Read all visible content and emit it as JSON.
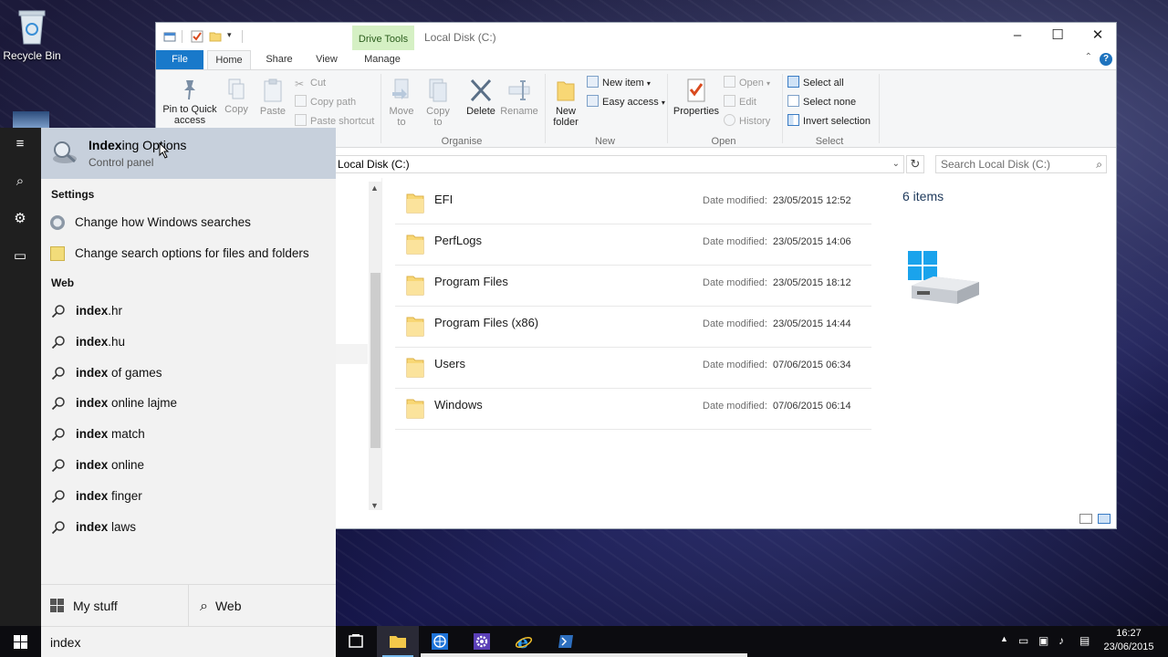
{
  "desktop": {
    "recycle_bin_label": "Recycle Bin"
  },
  "explorer": {
    "contextual_tab_label": "Drive Tools",
    "window_title": "Local Disk (C:)",
    "tabs": {
      "file": "File",
      "home": "Home",
      "share": "Share",
      "view": "View",
      "manage": "Manage"
    },
    "ribbon": {
      "clipboard": {
        "pin_label": "Pin to Quick access",
        "copy_label": "Copy",
        "paste_label": "Paste",
        "cut_label": "Cut",
        "copy_path_label": "Copy path",
        "paste_shortcut_label": "Paste shortcut"
      },
      "organise": {
        "move_to_label": "Move to",
        "copy_to_label": "Copy to",
        "delete_label": "Delete",
        "rename_label": "Rename",
        "group_label": "Organise"
      },
      "new": {
        "new_folder_label": "New folder",
        "new_item_label": "New item",
        "easy_access_label": "Easy access",
        "group_label": "New"
      },
      "open": {
        "properties_label": "Properties",
        "open_label": "Open",
        "edit_label": "Edit",
        "history_label": "History",
        "group_label": "Open"
      },
      "select": {
        "select_all_label": "Select all",
        "select_none_label": "Select none",
        "invert_selection_label": "Invert selection",
        "group_label": "Select"
      }
    },
    "address": "Local Disk (C:)",
    "search_placeholder": "Search Local Disk (C:)",
    "date_modified_label": "Date modified:",
    "files": [
      {
        "name": "EFI",
        "date": "23/05/2015 12:52"
      },
      {
        "name": "PerfLogs",
        "date": "23/05/2015 14:06"
      },
      {
        "name": "Program Files",
        "date": "23/05/2015 18:12"
      },
      {
        "name": "Program Files (x86)",
        "date": "23/05/2015 14:44"
      },
      {
        "name": "Users",
        "date": "07/06/2015 06:34"
      },
      {
        "name": "Windows",
        "date": "07/06/2015 06:14"
      }
    ],
    "item_count": "6 items"
  },
  "search_panel": {
    "best_match": {
      "title_bold": "Index",
      "title_rest": "ing Options",
      "subtitle": "Control panel"
    },
    "settings_header": "Settings",
    "settings_items": [
      {
        "label": "Change how Windows searches"
      },
      {
        "label": "Change search options for files and folders"
      }
    ],
    "web_header": "Web",
    "web_items": [
      {
        "bold": "index",
        "rest": ".hr"
      },
      {
        "bold": "index",
        "rest": ".hu"
      },
      {
        "bold": "index",
        "rest": " of games"
      },
      {
        "bold": "index",
        "rest": " online lajme"
      },
      {
        "bold": "index",
        "rest": " match"
      },
      {
        "bold": "index",
        "rest": " online"
      },
      {
        "bold": "index",
        "rest": " finger"
      },
      {
        "bold": "index",
        "rest": " laws"
      }
    ],
    "scope_my_stuff": "My stuff",
    "scope_web": "Web",
    "query": "index"
  },
  "taskbar": {
    "time": "16:27",
    "date": "23/06/2015"
  },
  "colors": {
    "accent": "#1979ca",
    "drive_tools_tab": "#d5f0c4",
    "best_match_highlight": "#c7d0dc",
    "taskbar": "#0c0c10"
  }
}
